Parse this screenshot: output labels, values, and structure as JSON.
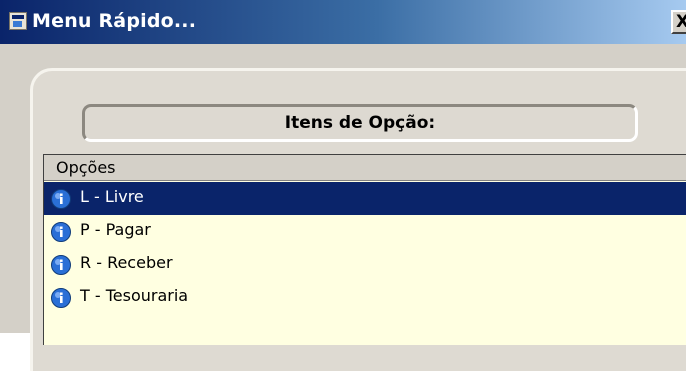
{
  "window": {
    "title": "Menu Rápido...",
    "close_symbol": "X"
  },
  "group": {
    "label": "Itens de Opção:"
  },
  "list": {
    "column_header": "Opções",
    "selected_index": 0,
    "items": [
      {
        "label": "L - Livre",
        "icon": "info-icon"
      },
      {
        "label": "P - Pagar",
        "icon": "info-icon"
      },
      {
        "label": "R - Receber",
        "icon": "info-icon"
      },
      {
        "label": "T - Tesouraria",
        "icon": "info-icon"
      }
    ]
  },
  "colors": {
    "titlebar_start": "#0a246a",
    "titlebar_end": "#a6caf0",
    "selection": "#0a246a",
    "list_background": "#ffffe1",
    "window_face": "#d4d0c8"
  }
}
